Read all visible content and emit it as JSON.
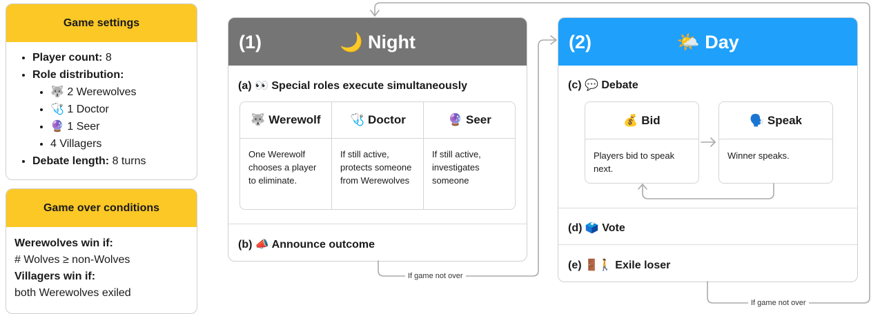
{
  "settings": {
    "title": "Game settings",
    "player_count_label": "Player count:",
    "player_count_value": "8",
    "role_distribution_label": "Role distribution:",
    "roles": [
      "🐺 2 Werewolves",
      "🩺 1 Doctor",
      "🔮 1 Seer",
      "4 Villagers"
    ],
    "debate_length_label": "Debate length:",
    "debate_length_value": "8 turns"
  },
  "game_over": {
    "title": "Game over conditions",
    "werewolves_label": "Werewolves win if:",
    "werewolves_condition": "# Wolves ≥ non-Wolves",
    "villagers_label": "Villagers win if:",
    "villagers_condition": "both Werewolves exiled"
  },
  "night": {
    "number": "(1)",
    "title": "🌙 Night",
    "step_a": "(a) 👀 Special roles execute simultaneously",
    "roles": [
      {
        "name": "🐺 Werewolf",
        "desc": "One Werewolf chooses a player to eliminate."
      },
      {
        "name": "🩺 Doctor",
        "desc": "If still active, protects someone from Werewolves"
      },
      {
        "name": "🔮 Seer",
        "desc": "If still active, investigates someone"
      }
    ],
    "step_b": "(b) 📣 Announce outcome"
  },
  "day": {
    "number": "(2)",
    "title": "🌤️ Day",
    "step_c": "(c) 💬 Debate",
    "bid": {
      "title": "💰 Bid",
      "desc": "Players bid to speak next."
    },
    "speak": {
      "title": "🗣️ Speak",
      "desc": "Winner speaks."
    },
    "step_d": "(d) 🗳️ Vote",
    "step_e": "(e) 🚪🚶 Exile loser"
  },
  "flow": {
    "night_to_day_label": "If game not over",
    "day_to_night_label": "If game not over"
  },
  "colors": {
    "settings_header": "#fbc826",
    "night_header": "#757575",
    "day_header": "#1ea0fb",
    "arrow": "#aaaaaa"
  }
}
